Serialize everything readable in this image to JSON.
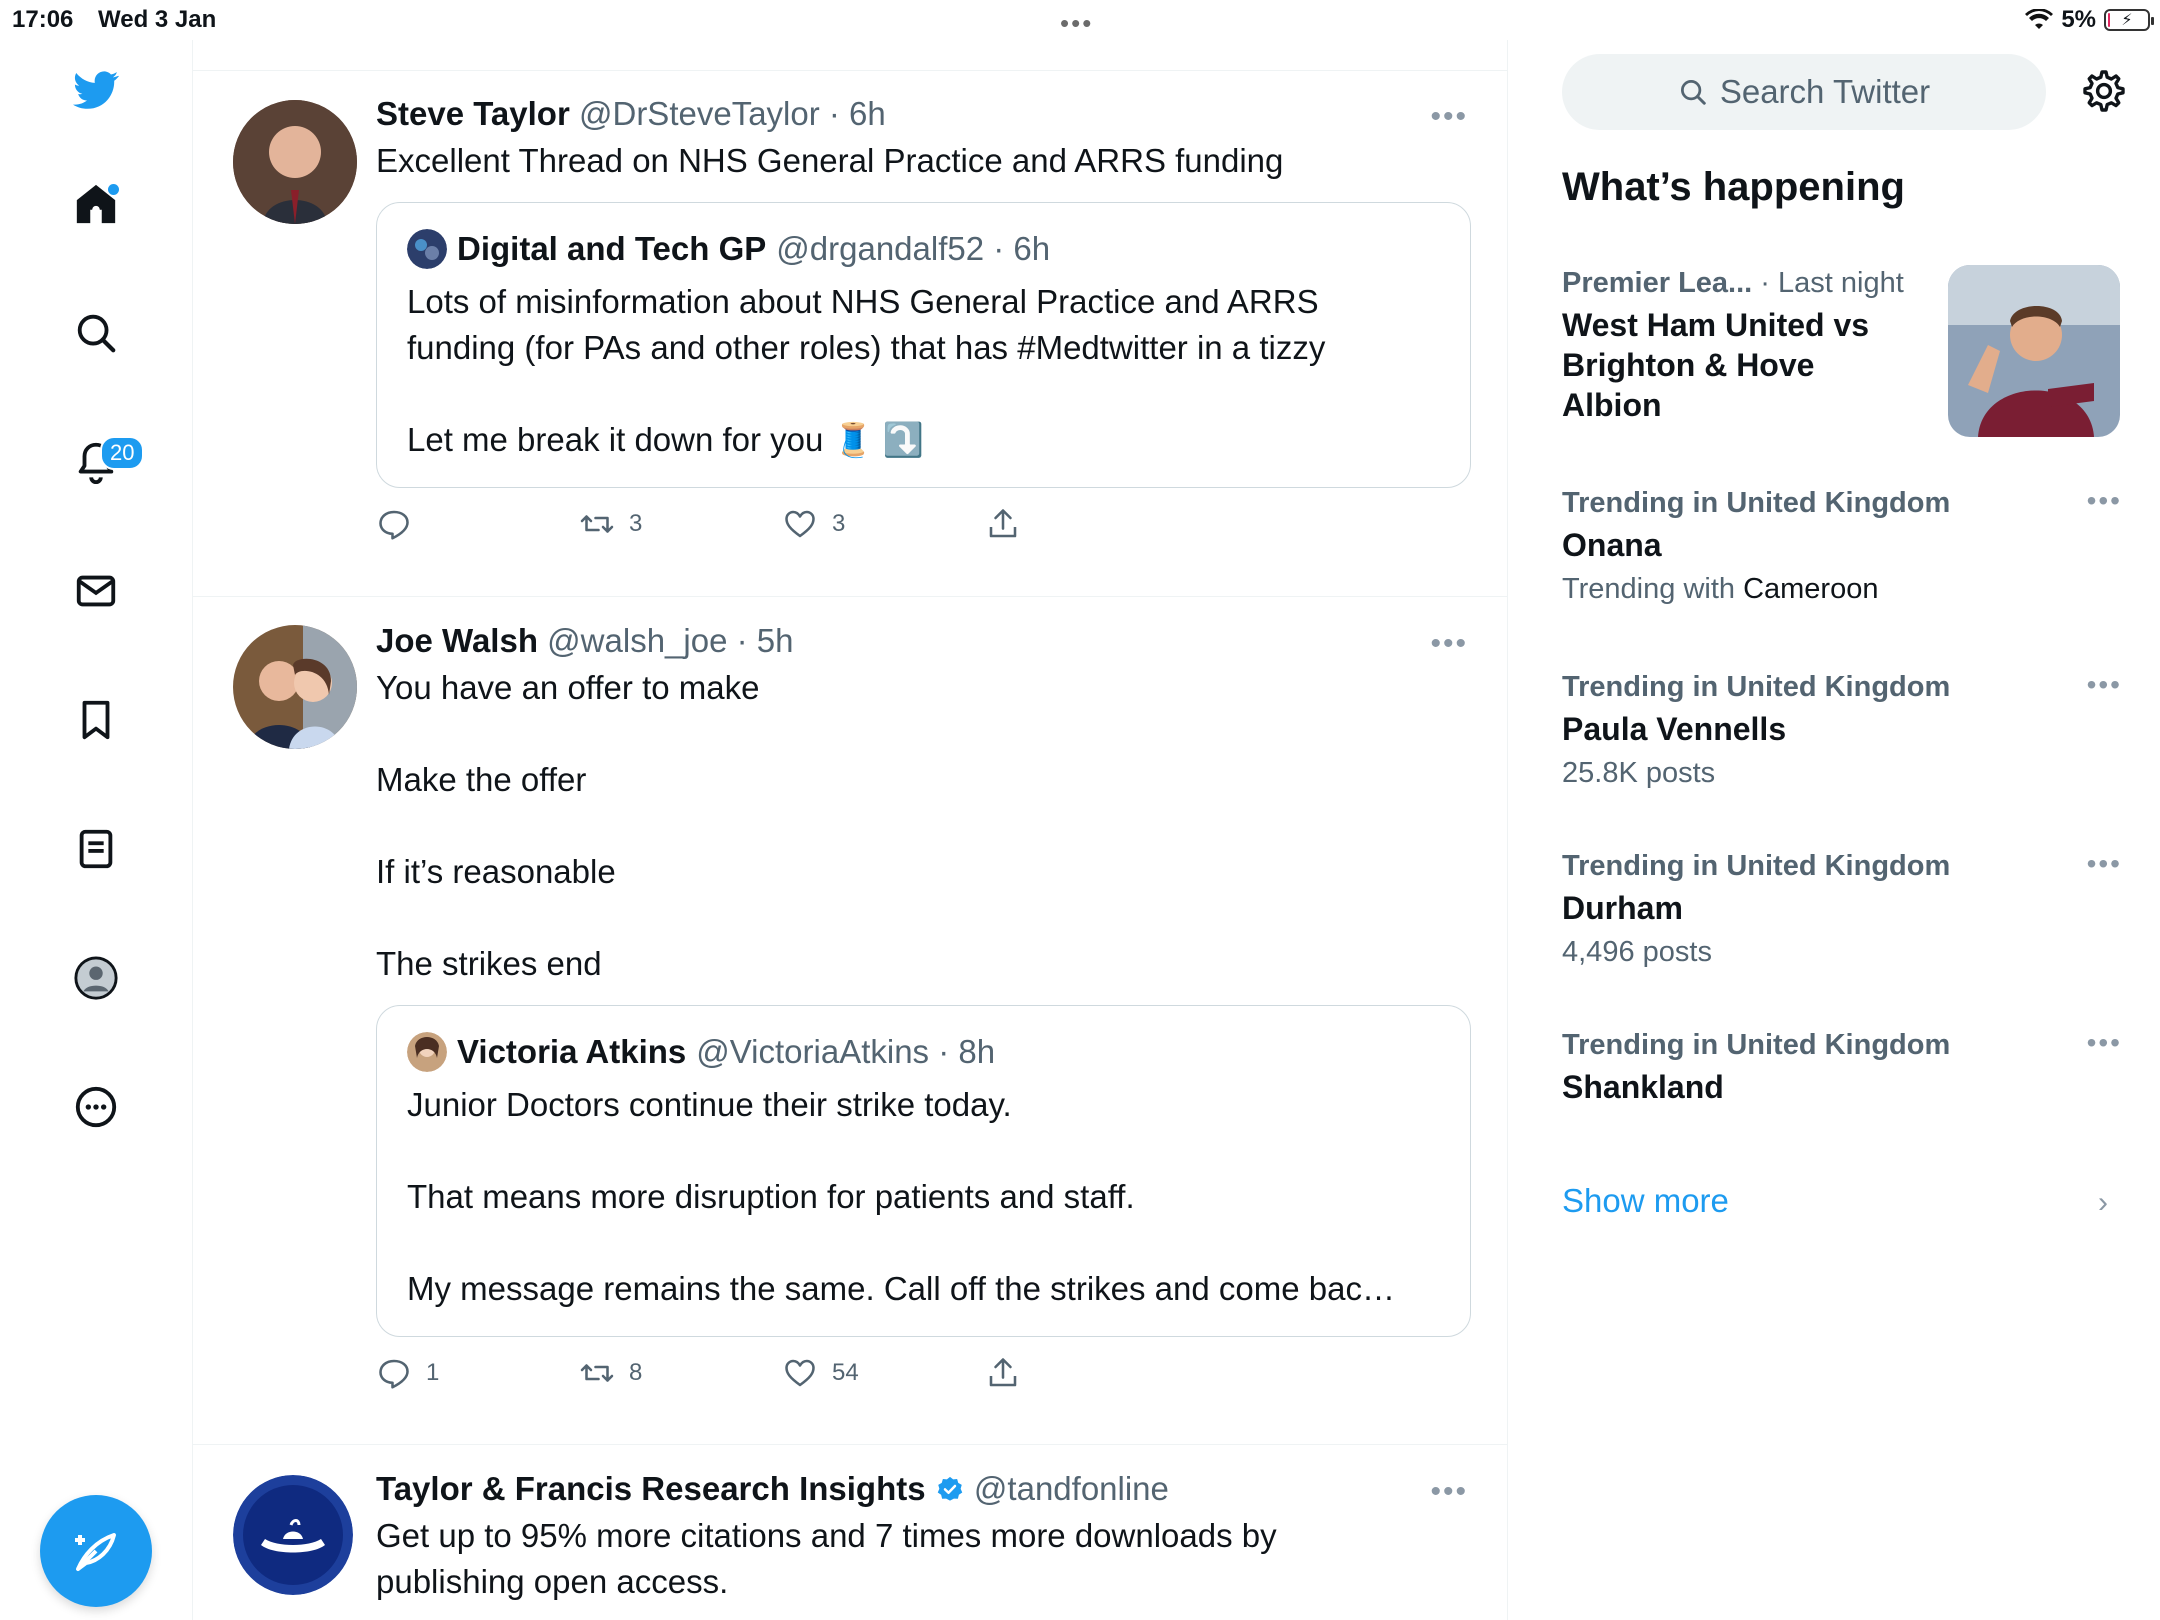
{
  "status_bar": {
    "time": "17:06",
    "date": "Wed 3 Jan",
    "battery": "5%",
    "battery_level": 0.05
  },
  "nav": {
    "notifications_badge": "20",
    "accent_color": "#1d9bf0"
  },
  "tweets": [
    {
      "name": "Steve Taylor",
      "meta": "@DrSteveTaylor · 6h",
      "text_lines": [
        "Excellent Thread on NHS General Practice and ARRS funding"
      ],
      "quote": {
        "name": "Digital and Tech GP",
        "meta": "@drgandalf52 · 6h",
        "lines": [
          "Lots of misinformation about NHS General Practice and ARRS",
          "funding (for PAs and other roles) that has #Medtwitter in a tizzy",
          "",
          "Let me break it down for you 🧵 ⤵️"
        ]
      },
      "reply_count": "",
      "retweet_count": "3",
      "like_count": "3"
    },
    {
      "name": "Joe Walsh",
      "meta": "@walsh_joe · 5h",
      "text_lines": [
        "You have an offer to make",
        "",
        "Make the offer",
        "",
        "If it’s reasonable",
        "",
        "The strikes end"
      ],
      "quote": {
        "name": "Victoria Atkins",
        "meta": "@VictoriaAtkins · 8h",
        "lines": [
          "Junior Doctors continue their strike today.",
          "",
          "That means more disruption for patients and staff.",
          "",
          "My message remains the same. Call off the strikes and come bac…"
        ]
      },
      "reply_count": "1",
      "retweet_count": "8",
      "like_count": "54"
    },
    {
      "name": "Taylor & Francis Research Insights",
      "meta": "@tandfonline",
      "verified": true,
      "text_lines": [
        "Get up to 95% more citations and 7 times more downloads by",
        "publishing open access."
      ]
    }
  ],
  "sidebar": {
    "search_placeholder": "Search Twitter",
    "whats_happening": "What’s happening",
    "trends": [
      {
        "context": "Premier Lea...",
        "time": "· Last night",
        "title_lines": [
          "West Ham United vs",
          "Brighton & Hove",
          "Albion"
        ]
      },
      {
        "context": "Trending in United Kingdom",
        "title": "Onana",
        "sub_prefix": "Trending with",
        "sub_with": "Cameroon"
      },
      {
        "context": "Trending in United Kingdom",
        "title": "Paula Vennells",
        "sub": "25.8K posts"
      },
      {
        "context": "Trending in United Kingdom",
        "title": "Durham",
        "sub": "4,496 posts"
      },
      {
        "context": "Trending in United Kingdom",
        "title": "Shankland"
      }
    ],
    "show_more": "Show more"
  }
}
